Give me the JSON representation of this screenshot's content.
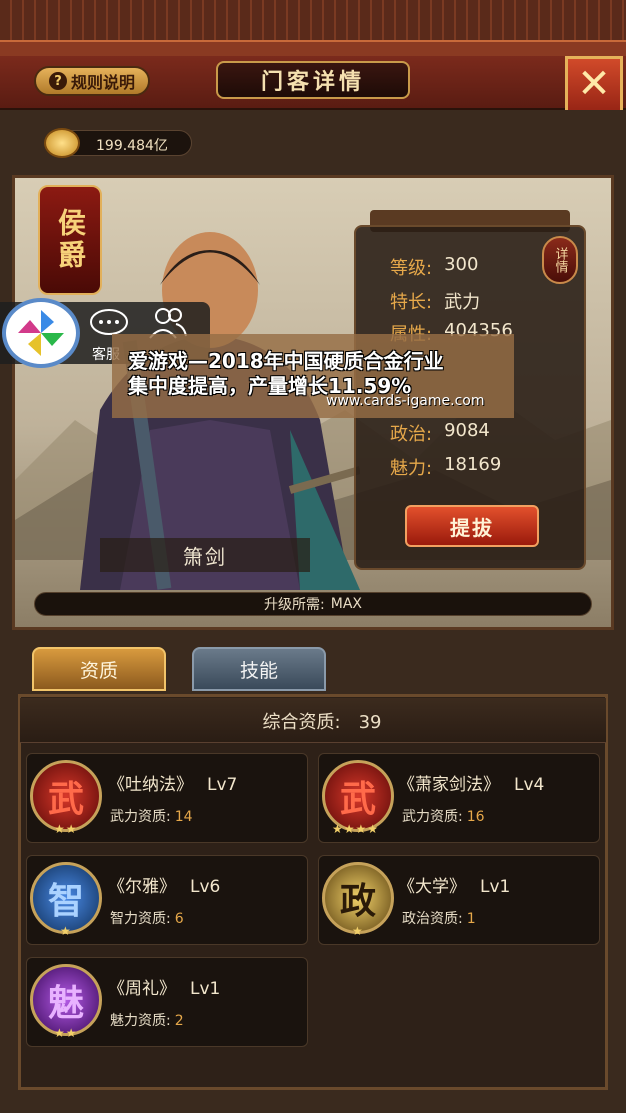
{
  "header": {
    "rules_label": "规则说明",
    "rules_icon": "?",
    "title": "门客详情",
    "close_icon": "✕"
  },
  "currency": {
    "amount": "199.484亿"
  },
  "hero": {
    "rank": "侯爵",
    "name": "箫剑",
    "upgrade_label": "升级所需:",
    "upgrade_value": "MAX"
  },
  "stats": [
    {
      "label": "等级:",
      "value": "300"
    },
    {
      "label": "特长:",
      "value": "武力"
    },
    {
      "label": "属性:",
      "value": "404356"
    },
    {
      "label": "政治:",
      "value": "9084"
    },
    {
      "label": "魅力:",
      "value": "18169"
    }
  ],
  "detail_label": "详情",
  "promote_label": "提拔",
  "overlay": {
    "service_label": "客服",
    "watermark_line1": "爱游戏—2018年中国硬质合金行业",
    "watermark_line2": "集中度提高，产量增长11.59%",
    "watermark_url": "www.cards-igame.com"
  },
  "tabs": {
    "quality": "资质",
    "skills": "技能"
  },
  "quality": {
    "label": "综合资质:",
    "value": "39"
  },
  "skills": [
    {
      "emblem": "武",
      "stars": "★★",
      "name": "《吐纳法》",
      "lv": "Lv7",
      "attr": "武力资质:",
      "value": "14"
    },
    {
      "emblem": "武",
      "stars": "★★★★",
      "name": "《萧家剑法》",
      "lv": "Lv4",
      "attr": "武力资质:",
      "value": "16"
    },
    {
      "emblem": "智",
      "stars": "★",
      "name": "《尔雅》",
      "lv": "Lv6",
      "attr": "智力资质:",
      "value": "6"
    },
    {
      "emblem": "政",
      "stars": "★",
      "name": "《大学》",
      "lv": "Lv1",
      "attr": "政治资质:",
      "value": "1"
    },
    {
      "emblem": "魅",
      "stars": "★★",
      "name": "《周礼》",
      "lv": "Lv1",
      "attr": "魅力资质:",
      "value": "2"
    }
  ]
}
